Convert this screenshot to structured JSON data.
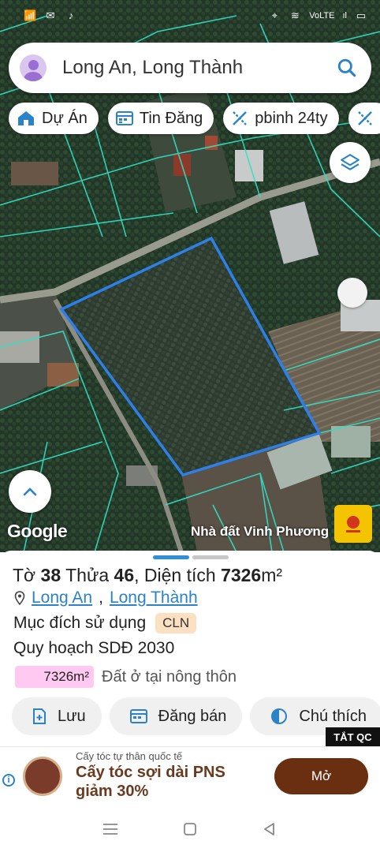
{
  "status_bar": {
    "carrier_left": "ıl",
    "network_label": "VoLTE"
  },
  "search": {
    "query": "Long An, Long Thành"
  },
  "chips": [
    {
      "label": "Dự Án",
      "icon": "house-icon"
    },
    {
      "label": "Tin Đăng",
      "icon": "listing-icon"
    },
    {
      "label": "pbinh 24ty",
      "icon": "measure-icon"
    },
    {
      "label": "",
      "icon": "measure-icon"
    }
  ],
  "map": {
    "google_label": "Google",
    "brand_label": "Nhà đất Vinh Phương",
    "parcel_outline_color": "#2f7fe8",
    "cadastral_line_color": "#33e0c4"
  },
  "parcel": {
    "sheet_label": "Tờ",
    "sheet_no": "38",
    "plot_label": "Thửa",
    "plot_no": "46",
    "area_label": "Diện tích",
    "area_value": "7326",
    "area_unit": "m²",
    "province": "Long An",
    "district": "Long Thành",
    "purpose_label": "Mục đích sử dụng",
    "purpose_code": "CLN",
    "plan_label": "Quy hoạch SDĐ 2030",
    "plan_area": "7326m²",
    "plan_use": "Đất ở tại nông thôn"
  },
  "actions": {
    "save": "Lưu",
    "post_sale": "Đăng bán",
    "legend": "Chú thích"
  },
  "ad": {
    "hide_label": "TẮT QC",
    "small_text": "Cấy tóc tự thân quốc tế",
    "headline": "Cấy tóc sợi dài PNS giảm 30%",
    "cta": "Mở"
  }
}
